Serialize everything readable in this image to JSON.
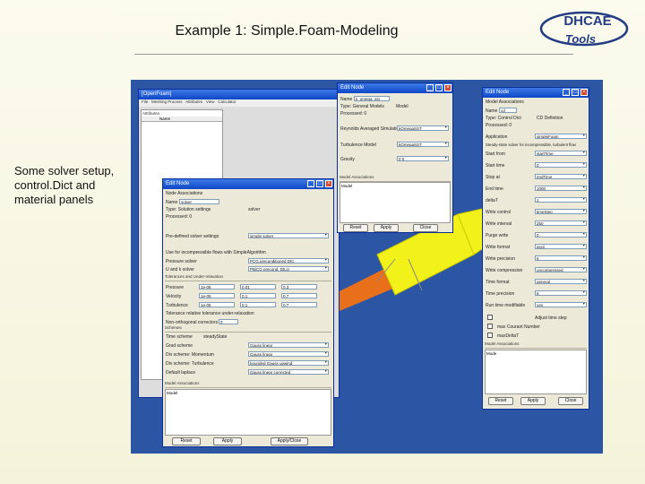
{
  "slide": {
    "title": "Example 1: Simple.Foam-Modeling",
    "side_text": "Some solver setup, control.Dict and material panels",
    "logo_top": "DHCAE",
    "logo_bottom": "Tools"
  },
  "colors": {
    "desktop": "#2c56a3",
    "titlebar": "#0d47c7",
    "panel": "#ece9d8",
    "model_yellow": "#f2f21a",
    "model_orange": "#e8701a"
  },
  "main_window": {
    "title": "[OpenFoam]",
    "menus": [
      "File",
      "Meshing Process",
      "Attributes",
      "View",
      "Calculator"
    ],
    "tree_header": "Attributes",
    "tree_col": "Name"
  },
  "mid_window": {
    "title": "Edit Node",
    "name_value": "k_omega_sst",
    "type_value": "Type: General Models",
    "type_right": "Model",
    "processed": "Processed: 0",
    "fields": [
      {
        "label": "Reynolds Averaged Simulation",
        "value": "kOmegaSST"
      },
      {
        "label": "Turbulence Model",
        "value": "kOmegaSST"
      },
      {
        "label": "Gravity",
        "value": "0 0"
      }
    ],
    "assoc": "Model Associations",
    "assoc_item": "Model",
    "buttons": [
      "Reset",
      "Apply",
      "Close"
    ]
  },
  "solver_window": {
    "title": "Edit Node",
    "tab": "Node Associations",
    "name_value": "solver",
    "type_value": "Type: Solution settings",
    "type_right": "solver",
    "processed": "Processed: 0",
    "predefined_label": "Pre-defined solver settings",
    "predefined_value": "simple solver",
    "incompressible_note": "Use for incompressible flows with SimpleAlgorithm",
    "pressure_label": "Pressure solver",
    "pressure_value": "PCG preconditioned DIC",
    "u_label": "U and k solver",
    "u_value": "PBiCG precond. DILU",
    "relax_heading": "Tolerances and Under-relaxation",
    "relax_rows": [
      {
        "name": "Pressure",
        "v1": "1e-06",
        "v2": "0.01",
        "v3": "0.3"
      },
      {
        "name": "Velocity",
        "v1": "1e-05",
        "v2": "0.1",
        "v3": "0.7"
      },
      {
        "name": "Turbulence",
        "v1": "1e-05",
        "v2": "0.1",
        "v3": "0.7"
      }
    ],
    "relax_cols": "Tolerance   relative tolerance   under-relaxation",
    "non_ortho_label": "Non-orthogonal correctors",
    "non_ortho_value": "0",
    "schemes_heading": "Schemes",
    "schemes": [
      {
        "label": "Grad scheme",
        "value": "Gauss linear"
      },
      {
        "label": "Div scheme: Momentum",
        "value": "Gauss linear"
      },
      {
        "label": "Div scheme: Turbulence",
        "value": "bounded Gauss upwind"
      },
      {
        "label": "Default laplace",
        "value": "Gauss linear corrected"
      }
    ],
    "time_scheme_label": "Time scheme",
    "time_scheme_value": "steadyState",
    "assoc": "Model Associations",
    "assoc_item": "Model",
    "buttons": [
      "Reset",
      "Apply",
      "Apply/Close"
    ]
  },
  "right_window": {
    "title": "Edit Node",
    "tab": "Model Associations",
    "name_value": "cd",
    "type_value": "Type: Control Dict",
    "type_right": "CD Definition",
    "processed": "Processed: 0",
    "app_label": "Application",
    "app_value": "simpleFoam",
    "desc": "Steady-state solver for incompressible, turbulent flow",
    "fields": [
      {
        "label": "Start from",
        "value": "startTime"
      },
      {
        "label": "Start time",
        "value": "0"
      },
      {
        "label": "Stop at",
        "value": "endTime"
      },
      {
        "label": "End time",
        "value": "1000"
      },
      {
        "label": "deltaT",
        "value": "1"
      },
      {
        "label": "Write control",
        "value": "timeStep"
      },
      {
        "label": "Write interval",
        "value": "250"
      },
      {
        "label": "Purge write",
        "value": "0"
      },
      {
        "label": "Write format",
        "value": "ascii"
      },
      {
        "label": "Write precision",
        "value": "6"
      },
      {
        "label": "Write compression",
        "value": "uncompressed"
      },
      {
        "label": "Time format",
        "value": "general"
      },
      {
        "label": "Time precision",
        "value": "6"
      },
      {
        "label": "Run time modifiable",
        "value": "yes"
      }
    ],
    "adjust_label": "Adjust time step",
    "maxco_label": "max Courant Number",
    "maxdelta_label": "maxDeltaT",
    "assoc": "Model Associations",
    "assoc_item": "Mode",
    "buttons": [
      "Reset",
      "Apply",
      "Close"
    ]
  }
}
